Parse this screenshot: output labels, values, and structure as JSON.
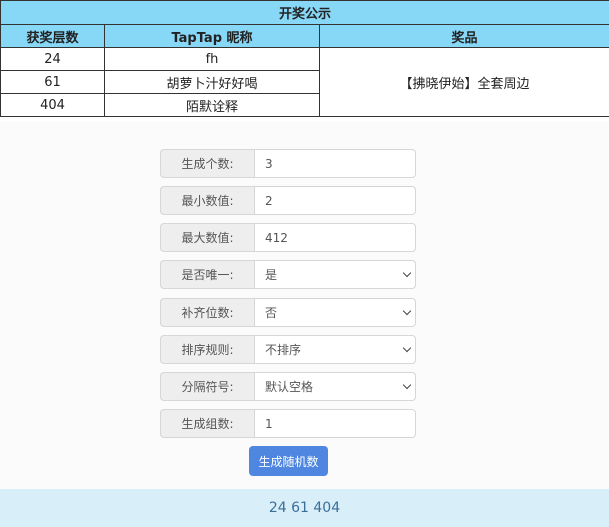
{
  "table": {
    "title": "开奖公示",
    "headers": [
      "获奖层数",
      "TapTap 昵称",
      "奖品"
    ],
    "rows": [
      {
        "floor": "24",
        "nickname": "fh"
      },
      {
        "floor": "61",
        "nickname": "胡萝卜汁好好喝"
      },
      {
        "floor": "404",
        "nickname": "陌默诠释"
      }
    ],
    "prize": "【拂晓伊始】全套周边"
  },
  "form": {
    "count": {
      "label": "生成个数:",
      "value": "3"
    },
    "min": {
      "label": "最小数值:",
      "value": "2"
    },
    "max": {
      "label": "最大数值:",
      "value": "412"
    },
    "unique": {
      "label": "是否唯一:",
      "value": "是"
    },
    "padding": {
      "label": "补齐位数:",
      "value": "否"
    },
    "sort": {
      "label": "排序规则:",
      "value": "不排序"
    },
    "separator": {
      "label": "分隔符号:",
      "value": "默认空格"
    },
    "groups": {
      "label": "生成组数:",
      "value": "1"
    }
  },
  "button": {
    "label": "生成随机数"
  },
  "result": {
    "text": "24 61 404"
  }
}
